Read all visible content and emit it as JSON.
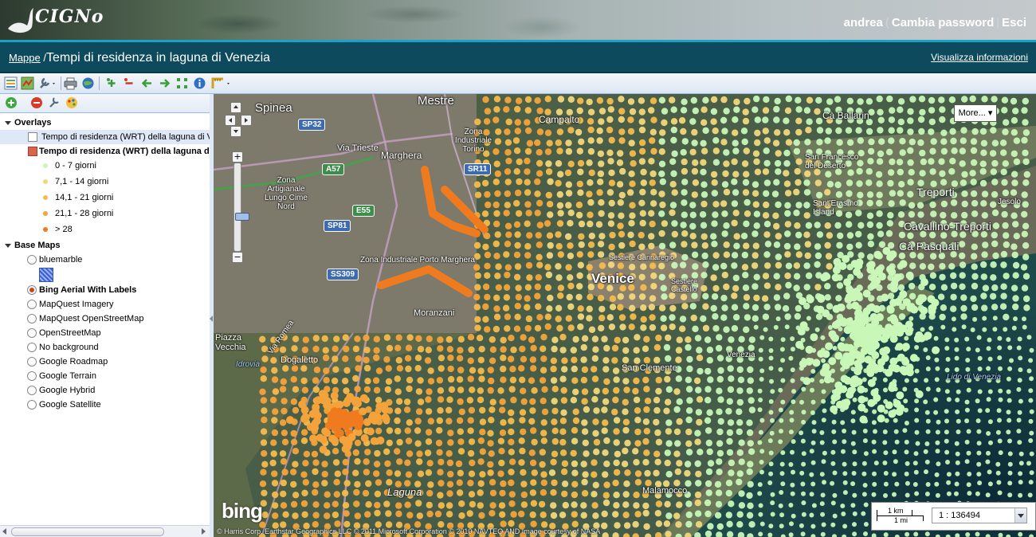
{
  "header": {
    "logo_text": "CIGNo",
    "user": "andrea",
    "change_password": "Cambia password",
    "logout": "Esci"
  },
  "titlebar": {
    "breadcrumb_root": "Mappe",
    "separator": "/",
    "title": "Tempi di residenza in laguna di Venezia",
    "info_link": "Visualizza informazioni"
  },
  "toolbar_icons": [
    "layer-properties-icon",
    "map-export-icon",
    "tools-dropdown-icon",
    "print-icon",
    "google-earth-icon",
    "zoom-in-icon",
    "zoom-out-icon",
    "back-icon",
    "forward-icon",
    "zoom-extent-icon",
    "info-icon",
    "measure-dropdown-icon"
  ],
  "sidebar": {
    "toolbar_icons": [
      "add-layer-icon",
      "remove-layer-icon",
      "layer-settings-icon",
      "style-icon"
    ],
    "overlays_label": "Overlays",
    "overlays": [
      {
        "label": "Tempo di residenza (WRT) della laguna di V",
        "checked": false
      },
      {
        "label": "Tempo di residenza (WRT) della laguna di",
        "checked": true
      }
    ],
    "legend": [
      {
        "label": "0 - 7  giorni",
        "color": "#c8f7b8"
      },
      {
        "label": "7,1 - 14  giorni",
        "color": "#f2d77a"
      },
      {
        "label": "14,1 - 21  giorni",
        "color": "#f6bb4c"
      },
      {
        "label": "21,1 - 28  giorni",
        "color": "#f4a33a"
      },
      {
        "label": "> 28",
        "color": "#f07a1e"
      }
    ],
    "base_maps_label": "Base Maps",
    "base_maps": [
      {
        "label": "bluemarble",
        "selected": false
      },
      {
        "label": "Bing Aerial With Labels",
        "selected": true
      },
      {
        "label": "MapQuest Imagery",
        "selected": false
      },
      {
        "label": "MapQuest OpenStreetMap",
        "selected": false
      },
      {
        "label": "OpenStreetMap",
        "selected": false
      },
      {
        "label": "No background",
        "selected": false
      },
      {
        "label": "Google Roadmap",
        "selected": false
      },
      {
        "label": "Google Terrain",
        "selected": false
      },
      {
        "label": "Google Hybrid",
        "selected": false
      },
      {
        "label": "Google Satellite",
        "selected": false
      }
    ]
  },
  "map": {
    "place_labels": [
      {
        "text": "Mestre",
        "size": "big"
      },
      {
        "text": "Spinea",
        "size": "big"
      },
      {
        "text": "Campalto",
        "size": "small"
      },
      {
        "text": "Marghera",
        "size": "small"
      },
      {
        "text": "Via Trieste",
        "size": "small"
      },
      {
        "text": "Zona Industriale Torino",
        "size": "small"
      },
      {
        "text": "Zona Artigianale Lungo Cime Nord",
        "size": "small"
      },
      {
        "text": "Zona Industriale Porto Marghera",
        "size": "small"
      },
      {
        "text": "Moranzani",
        "size": "small"
      },
      {
        "text": "Dogaletto",
        "size": "small"
      },
      {
        "text": "Via Romea",
        "size": "small"
      },
      {
        "text": "Piazza Vecchia",
        "size": "small"
      },
      {
        "text": "Idrovia",
        "size": "small"
      },
      {
        "text": "Venice",
        "size": "big"
      },
      {
        "text": "Sestiere Cannaregio",
        "size": "small"
      },
      {
        "text": "Sestiere Castello",
        "size": "small"
      },
      {
        "text": "Venezia",
        "size": "small"
      },
      {
        "text": "Treporti",
        "size": "big"
      },
      {
        "text": "Cavallino-Treporti",
        "size": "big"
      },
      {
        "text": "Cà Pasquali",
        "size": "small"
      },
      {
        "text": "Sant'Erasmo Island",
        "size": "small"
      },
      {
        "text": "San Francesco del Deserto",
        "size": "small"
      },
      {
        "text": "Cà Ballarin",
        "size": "small"
      },
      {
        "text": "Jesolo",
        "size": "small"
      },
      {
        "text": "Lido di Venezia",
        "size": "small"
      },
      {
        "text": "San Clemente",
        "size": "small"
      },
      {
        "text": "Malamocco",
        "size": "small"
      },
      {
        "text": "Laguna",
        "size": "small"
      }
    ],
    "road_shields": [
      {
        "text": "SP32",
        "kind": "b"
      },
      {
        "text": "SR11",
        "kind": "b"
      },
      {
        "text": "A57",
        "kind": "g"
      },
      {
        "text": "E55",
        "kind": "g"
      },
      {
        "text": "SP81",
        "kind": "b"
      },
      {
        "text": "SS309",
        "kind": "b"
      }
    ],
    "more_button": "More...",
    "scale_km": "1 km",
    "scale_mi": "1 mi",
    "scale_ratio": "1 : 136494",
    "bing_logo": "bing",
    "attribution": "© Harris Corp, Earthstar Geographics LLC © 2011 Microsoft Corporation © 2010 NAVTEQ AND Image courtesy of NASA"
  }
}
